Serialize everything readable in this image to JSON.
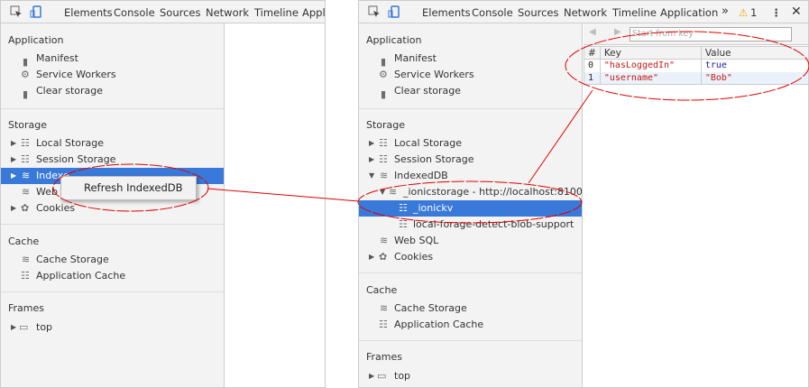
{
  "tabs": [
    "Elements",
    "Console",
    "Sources",
    "Network",
    "Timeline",
    "Application"
  ],
  "left_tab_truncated": "Applic",
  "more_tabs": "»",
  "warning_count": "1",
  "sidebar": {
    "application_header": "Application",
    "application_items": [
      "Manifest",
      "Service Workers",
      "Clear storage"
    ],
    "storage_header": "Storage",
    "storage_items": {
      "local": "Local Storage",
      "session": "Session Storage",
      "indexeddb": "IndexedDB",
      "websql": "Web SQL",
      "cookies": "Cookies"
    },
    "db": "_ionicstorage - http://localhost:8100",
    "stores": [
      "_ionickv",
      "local-forage-detect-blob-support"
    ],
    "cache_header": "Cache",
    "cache_items": [
      "Cache Storage",
      "Application Cache"
    ],
    "frames_header": "Frames",
    "frame": "top"
  },
  "context_menu": {
    "item": "Refresh IndexedDB"
  },
  "left_truncated": {
    "indexeddb": "Indexe",
    "websql": "Web S"
  },
  "data_view": {
    "key_placeholder": "Start from key",
    "columns": [
      "#",
      "Key",
      "Value"
    ],
    "rows": [
      [
        "0",
        "\"hasLoggedIn\"",
        "true"
      ],
      [
        "1",
        "\"username\"",
        "\"Bob\""
      ]
    ]
  },
  "colors": {
    "accent": "#3879d9",
    "annotation": "#e00000"
  }
}
